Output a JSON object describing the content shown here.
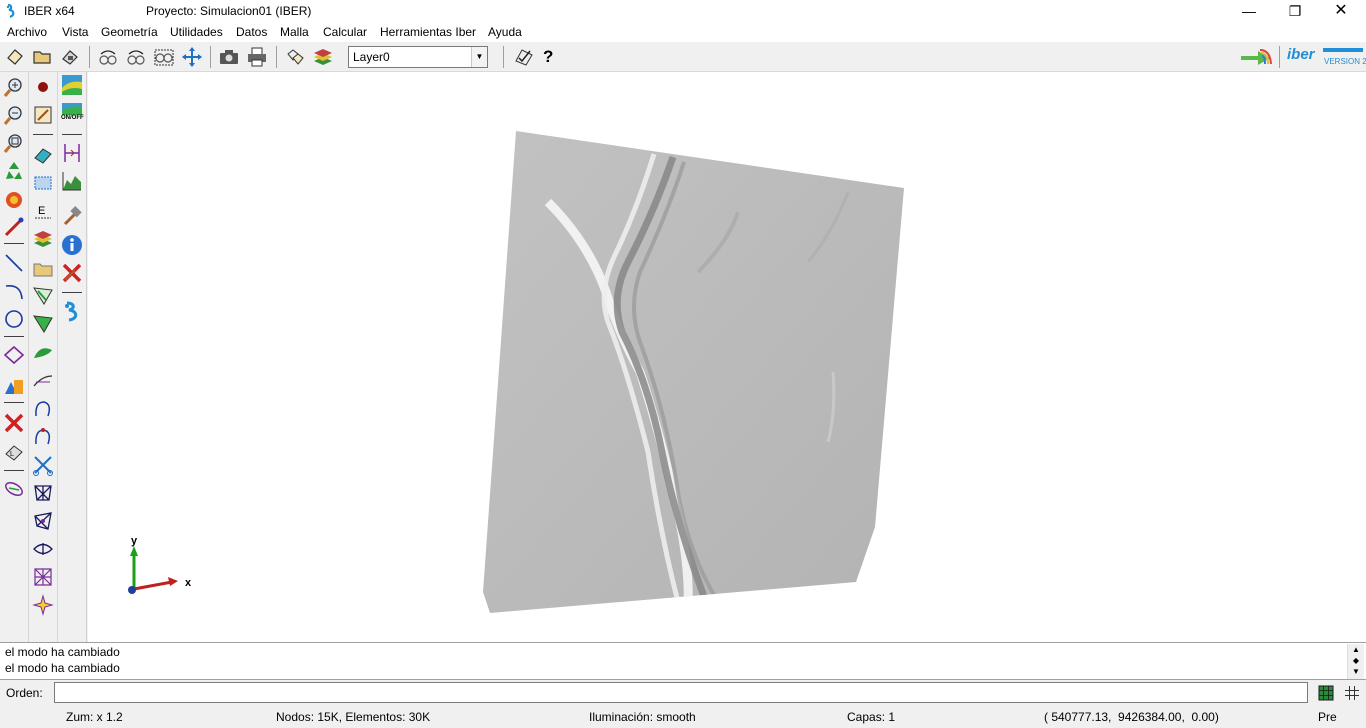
{
  "window": {
    "app_title": "IBER x64",
    "project_title": "Proyecto: Simulacion01 (IBER)",
    "minimize": "—",
    "maximize": "❐",
    "close": "✕"
  },
  "menu": [
    "Archivo",
    "Vista",
    "Geometría",
    "Utilidades",
    "Datos",
    "Malla",
    "Calcular",
    "Herramientas Iber",
    "Ayuda"
  ],
  "toolbar": {
    "layer_value": "Layer0",
    "help_label": "?",
    "brand_text": "iber",
    "brand_version": "VERSION 2",
    "icons": [
      "new-file",
      "open-folder",
      "save-disk",
      "rotate-left",
      "rotate-right",
      "zoom-frame",
      "pan-arrows",
      "camera",
      "printer",
      "copy-pages",
      "layers",
      "check-edit",
      "help"
    ]
  },
  "left_toolbar": {
    "col1": [
      "zoom-in",
      "zoom-out",
      "zoom-frame",
      "recycle",
      "fire-render",
      "measure-pencil",
      "line",
      "arc",
      "circle",
      "nurbs-surface",
      "solid-shapes",
      "delete-x",
      "list-entities",
      "swap-ellipse"
    ],
    "col2": [
      "red-dot",
      "edit-note",
      "eraser",
      "select-rect",
      "edit-text",
      "layers-stack",
      "folder",
      "select-triangle-1",
      "select-triangle-2",
      "green-leaf",
      "curve-arrow",
      "lasso-1",
      "lasso-2",
      "scissors",
      "mesh-1",
      "mesh-2",
      "mesh-3",
      "mesh-4",
      "mesh-star"
    ],
    "col3": [
      "colored-map",
      "on-off",
      "dimension",
      "profile-chart",
      "hammer",
      "info",
      "cross-tool",
      "iber-logo"
    ],
    "on_off_label": "ON/OFF"
  },
  "axes": {
    "x_label": "x",
    "y_label": "y"
  },
  "log": {
    "lines": [
      "el modo ha cambiado",
      "el modo ha cambiado"
    ]
  },
  "command": {
    "label": "Orden:",
    "value": ""
  },
  "status": {
    "zoom": "Zum: x 1.2",
    "nodes": "Nodos: 15K, Elementos: 30K",
    "lighting": "Iluminación: smooth",
    "layers": "Capas: 1",
    "coords": "( 540777.13,  9426384.00,  0.00)",
    "mode": "Pre"
  },
  "colors": {
    "terrain": "#b9b9b9",
    "highlight": "#f4f4f4",
    "shadow": "#8e8e8e",
    "iber_blue": "#1e8fd6"
  }
}
